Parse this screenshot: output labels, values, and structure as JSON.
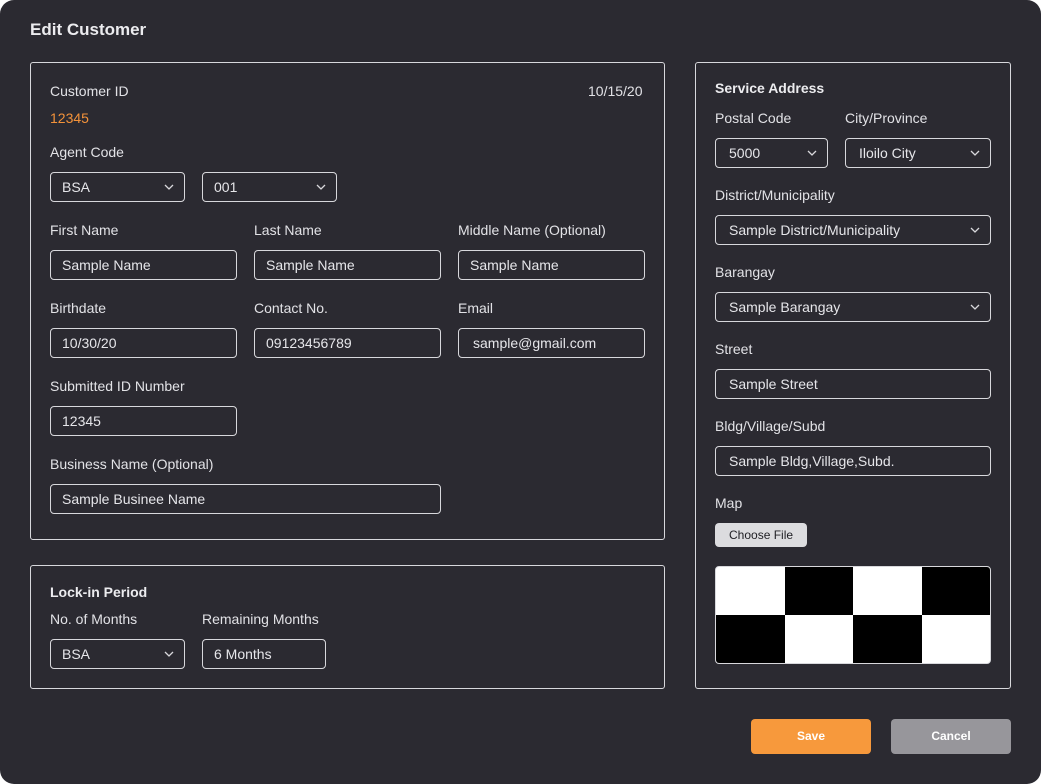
{
  "dialog": {
    "title": "Edit Customer"
  },
  "customer": {
    "id_label": "Customer ID",
    "id_value": "12345",
    "date": "10/15/20",
    "agent_code_label": "Agent Code",
    "agent_code_primary": "BSA",
    "agent_code_secondary": "001",
    "first_name_label": "First Name",
    "first_name": "Sample Name",
    "last_name_label": "Last Name",
    "last_name": "Sample Name",
    "middle_name_label": "Middle Name (Optional)",
    "middle_name": "Sample Name",
    "birthdate_label": "Birthdate",
    "birthdate": "10/30/20",
    "contact_label": "Contact No.",
    "contact": "09123456789",
    "email_label": "Email",
    "email": "sample@gmail.com",
    "submitted_id_label": "Submitted ID Number",
    "submitted_id": "12345",
    "business_name_label": "Business Name (Optional)",
    "business_name": "Sample Businee Name"
  },
  "lock_in": {
    "title": "Lock-in Period",
    "months_label": "No. of Months",
    "months_value": "BSA",
    "remaining_label": "Remaining Months",
    "remaining_value": "6 Months"
  },
  "service_address": {
    "title": "Service Address",
    "postal_label": "Postal Code",
    "postal_value": "5000",
    "city_label": "City/Province",
    "city_value": "Iloilo City",
    "district_label": "District/Municipality",
    "district_value": "Sample District/Municipality",
    "barangay_label": "Barangay",
    "barangay_value": "Sample Barangay",
    "street_label": "Street",
    "street_value": "Sample Street",
    "bldg_label": "Bldg/Village/Subd",
    "bldg_value": "Sample Bldg,Village,Subd.",
    "map_label": "Map",
    "choose_file_label": "Choose File"
  },
  "actions": {
    "save_label": "Save",
    "cancel_label": "Cancel"
  },
  "colors": {
    "background": "#2b2a31",
    "accent": "#f7993c",
    "cancel": "#97969b",
    "text": "#e6e6ea"
  },
  "icons": {
    "dropdown": "chevron-down-icon"
  }
}
